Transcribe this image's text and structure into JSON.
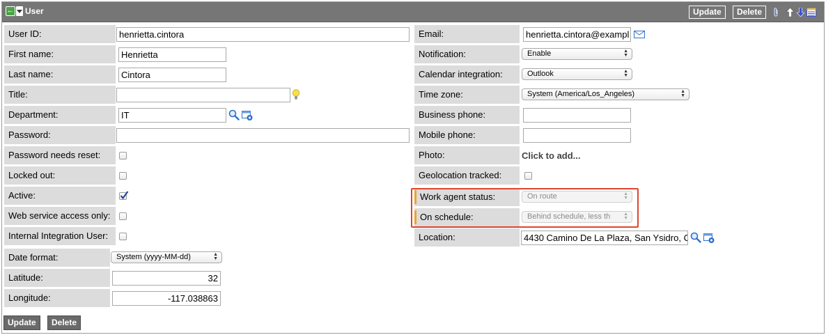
{
  "header": {
    "title": "User",
    "update_label": "Update",
    "delete_label": "Delete"
  },
  "left_fields": {
    "user_id": {
      "label": "User ID:",
      "value": "henrietta.cintora"
    },
    "first_name": {
      "label": "First name:",
      "value": "Henrietta"
    },
    "last_name": {
      "label": "Last name:",
      "value": "Cintora"
    },
    "title": {
      "label": "Title:",
      "value": ""
    },
    "department": {
      "label": "Department:",
      "value": "IT"
    },
    "password": {
      "label": "Password:",
      "value": ""
    },
    "password_needs_reset": {
      "label": "Password needs reset:",
      "checked": false
    },
    "locked_out": {
      "label": "Locked out:",
      "checked": false
    },
    "active": {
      "label": "Active:",
      "checked": true
    },
    "web_service_access_only": {
      "label": "Web service access only:",
      "checked": false
    },
    "internal_integration_user": {
      "label": "Internal Integration User:",
      "checked": false
    },
    "date_format": {
      "label": "Date format:",
      "value": "System (yyyy-MM-dd)"
    },
    "latitude": {
      "label": "Latitude:",
      "value": "32"
    },
    "longitude": {
      "label": "Longitude:",
      "value": "-117.038863"
    }
  },
  "right_fields": {
    "email": {
      "label": "Email:",
      "value": "henrietta.cintora@exampl"
    },
    "notification": {
      "label": "Notification:",
      "value": "Enable"
    },
    "calendar_integration": {
      "label": "Calendar integration:",
      "value": "Outlook"
    },
    "time_zone": {
      "label": "Time zone:",
      "value": "System (America/Los_Angeles)"
    },
    "business_phone": {
      "label": "Business phone:",
      "value": ""
    },
    "mobile_phone": {
      "label": "Mobile phone:",
      "value": ""
    },
    "photo": {
      "label": "Photo:",
      "value": "Click to add..."
    },
    "geolocation_tracked": {
      "label": "Geolocation tracked:",
      "checked": false
    },
    "work_agent_status": {
      "label": "Work agent status:",
      "value": "On route"
    },
    "on_schedule": {
      "label": "On schedule:",
      "value": "Behind schedule, less th"
    },
    "location": {
      "label": "Location:",
      "value": "4430 Camino De La Plaza, San Ysidro, C"
    }
  },
  "footer": {
    "update_label": "Update",
    "delete_label": "Delete"
  },
  "colors": {
    "titlebar": "#767676",
    "label_bg": "#dcdcdc",
    "mandatory_marker": "#e6a72b",
    "highlight": "#e0442c"
  }
}
